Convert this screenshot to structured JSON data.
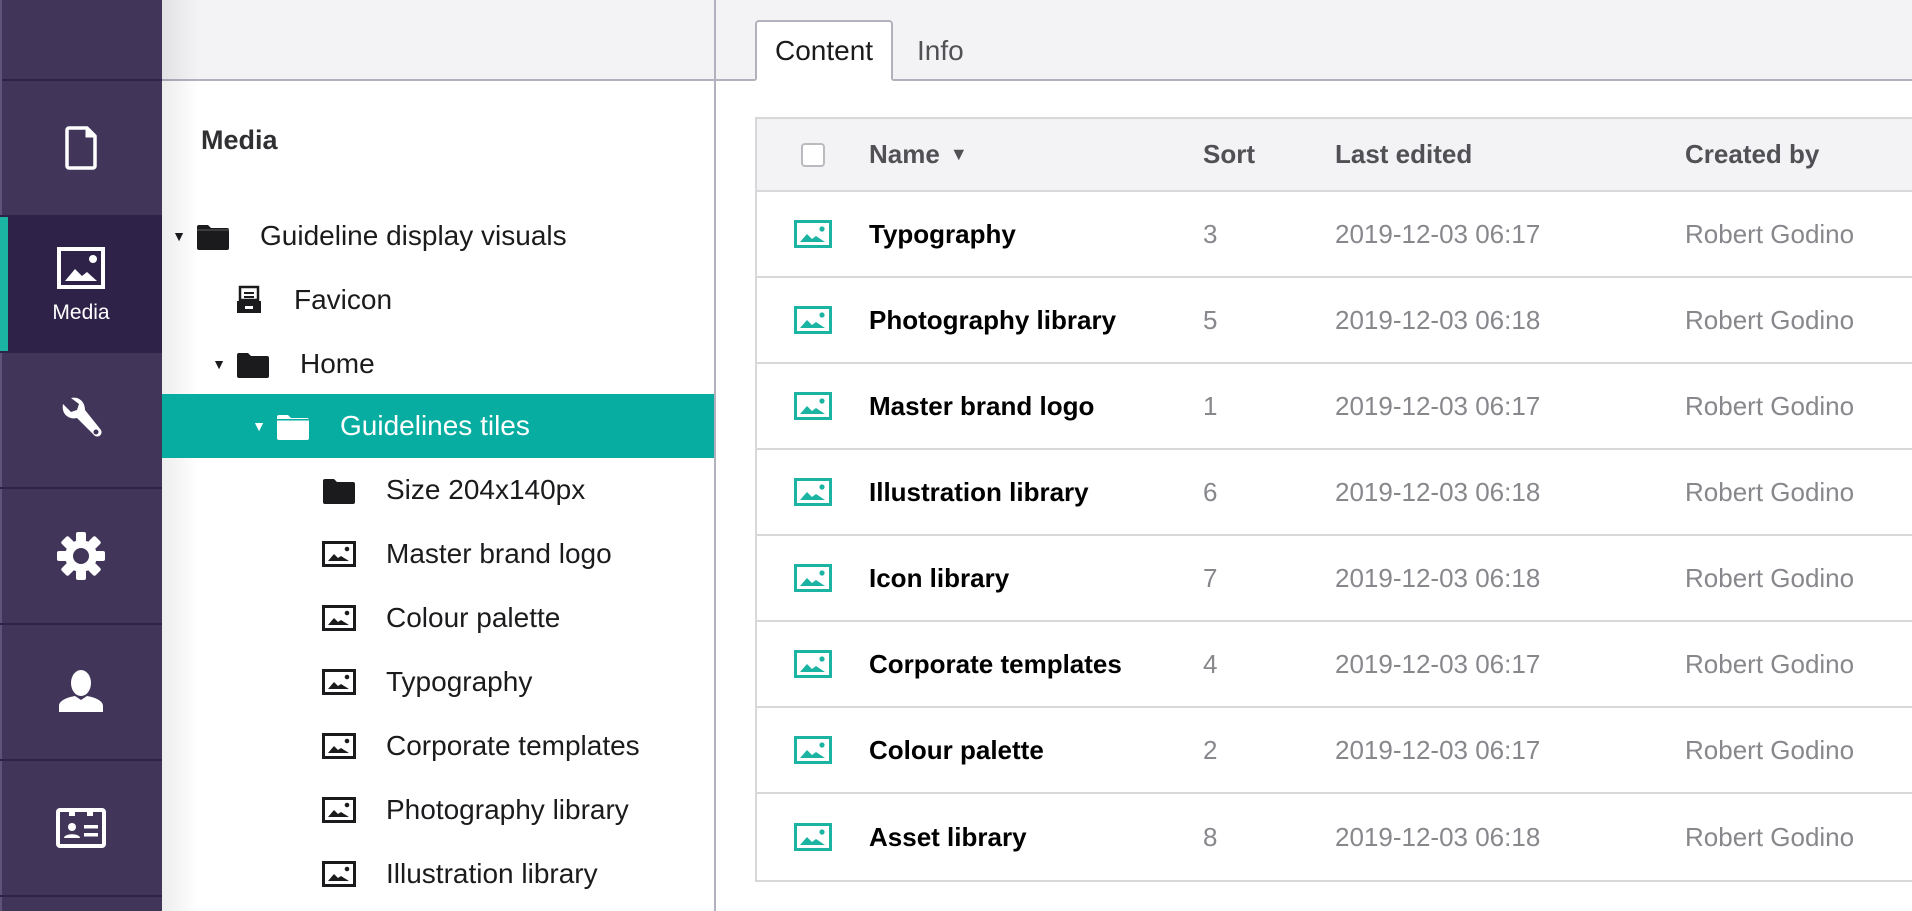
{
  "sections": [
    {
      "id": "content",
      "icon": "document-icon",
      "label": ""
    },
    {
      "id": "media",
      "icon": "image-icon",
      "label": "Media",
      "active": true
    },
    {
      "id": "settings",
      "icon": "wrench-icon",
      "label": ""
    },
    {
      "id": "packages",
      "icon": "gear-icon",
      "label": ""
    },
    {
      "id": "users",
      "icon": "user-icon",
      "label": ""
    },
    {
      "id": "members",
      "icon": "id-card-icon",
      "label": ""
    }
  ],
  "tree": {
    "title": "Media",
    "nodes": [
      {
        "label": "Guideline display visuals",
        "icon": "folder-icon",
        "expanded": true,
        "depth": 0
      },
      {
        "label": "Favicon",
        "icon": "file-drawer-icon",
        "depth": 1
      },
      {
        "label": "Home",
        "icon": "folder-icon",
        "expanded": true,
        "depth": 1
      },
      {
        "label": "Guidelines tiles",
        "icon": "folder-icon",
        "expanded": true,
        "depth": 2,
        "selected": true
      },
      {
        "label": "Size 204x140px",
        "icon": "folder-icon",
        "depth": 3
      },
      {
        "label": "Master brand logo",
        "icon": "image-icon",
        "depth": 3
      },
      {
        "label": "Colour palette",
        "icon": "image-icon",
        "depth": 3
      },
      {
        "label": "Typography",
        "icon": "image-icon",
        "depth": 3
      },
      {
        "label": "Corporate templates",
        "icon": "image-icon",
        "depth": 3
      },
      {
        "label": "Photography library",
        "icon": "image-icon",
        "depth": 3
      },
      {
        "label": "Illustration library",
        "icon": "image-icon",
        "depth": 3
      }
    ]
  },
  "tabs": [
    {
      "label": "Content",
      "active": true
    },
    {
      "label": "Info",
      "active": false
    }
  ],
  "table": {
    "columns": {
      "name": "Name",
      "sort": "Sort",
      "last_edited": "Last edited",
      "created_by": "Created by"
    },
    "sort_indicator": "▼",
    "rows": [
      {
        "name": "Typography",
        "sort": "3",
        "last_edited": "2019-12-03 06:17",
        "created_by": "Robert Godino"
      },
      {
        "name": "Photography library",
        "sort": "5",
        "last_edited": "2019-12-03 06:18",
        "created_by": "Robert Godino"
      },
      {
        "name": "Master brand logo",
        "sort": "1",
        "last_edited": "2019-12-03 06:17",
        "created_by": "Robert Godino"
      },
      {
        "name": "Illustration library",
        "sort": "6",
        "last_edited": "2019-12-03 06:18",
        "created_by": "Robert Godino"
      },
      {
        "name": "Icon library",
        "sort": "7",
        "last_edited": "2019-12-03 06:18",
        "created_by": "Robert Godino"
      },
      {
        "name": "Corporate templates",
        "sort": "4",
        "last_edited": "2019-12-03 06:17",
        "created_by": "Robert Godino"
      },
      {
        "name": "Colour palette",
        "sort": "2",
        "last_edited": "2019-12-03 06:17",
        "created_by": "Robert Godino"
      },
      {
        "name": "Asset library",
        "sort": "8",
        "last_edited": "2019-12-03 06:18",
        "created_by": "Robert Godino"
      }
    ]
  },
  "colors": {
    "sidebar_bg": "#413659",
    "sidebar_active_bg": "#2e2249",
    "accent": "#06ada0",
    "row_icon": "#1bb3a2"
  }
}
